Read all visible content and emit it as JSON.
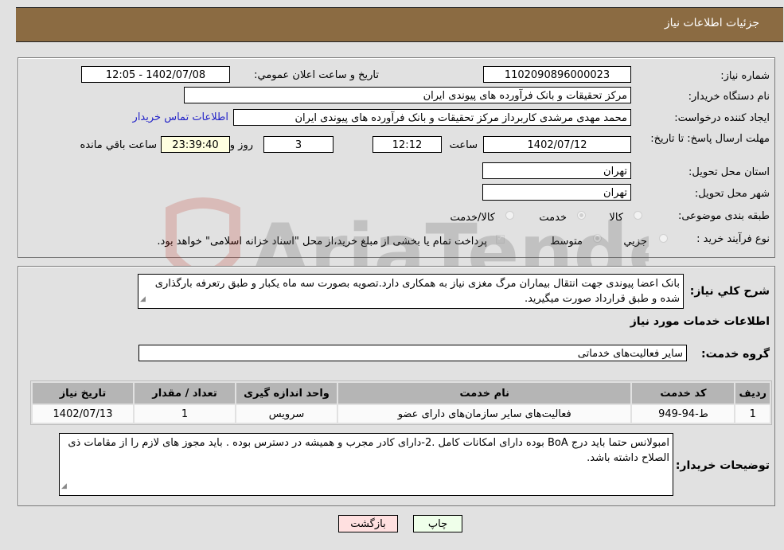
{
  "header": {
    "title": "جزئیات اطلاعات نیاز"
  },
  "need_info": {
    "need_number_label": "شماره نیاز:",
    "need_number": "1102090896000023",
    "announce_label": "تاریخ و ساعت اعلان عمومي:",
    "announce_value": "1402/07/08 - 12:05",
    "buyer_org_label": "نام دستگاه خریدار:",
    "buyer_org": "مرکز تحقیقات و بانک فرآورده های پیوندی ایران",
    "creator_label": "ایجاد کننده درخواست:",
    "creator": "محمد مهدی  مرشدی کاربرداز مرکز تحقیقات و بانک فرآورده های پیوندی ایران",
    "buyer_contact_link": "اطلاعات تماس خریدار",
    "deadline_label": "مهلت ارسال پاسخ: تا تاریخ:",
    "deadline_date": "1402/07/12",
    "time_label": "ساعت",
    "deadline_time": "12:12",
    "days_value": "3",
    "days_label": "روز و",
    "remaining_time": "23:39:40",
    "remaining_label": "ساعت باقي مانده",
    "province_label": "استان محل تحویل:",
    "province": "تهران",
    "city_label": "شهر محل تحویل:",
    "city": "تهران",
    "category_label": "طبقه بندی موضوعی:",
    "category_options": [
      {
        "label": "کالا",
        "selected": false
      },
      {
        "label": "خدمت",
        "selected": true
      },
      {
        "label": "کالا/خدمت",
        "selected": false
      }
    ],
    "process_label": "نوع فرآیند خرید :",
    "process_options": [
      {
        "label": "جزيي",
        "selected": false
      },
      {
        "label": "متوسط",
        "selected": true
      }
    ],
    "treasury_note": "پرداخت تمام یا بخشی از مبلغ خرید،از محل \"اسناد خزانه اسلامی\" خواهد بود.",
    "treasury_checked": true
  },
  "description": {
    "label": "شرح كلي نياز:",
    "text": "بانک اعضا پیوندی جهت انتقال بیماران مرگ مغزی نیاز به همکاری دارد.تصویه بصورت سه ماه یکبار و طبق رتعرفه بارگذاری شده و طبق قرارداد صورت میگیرید."
  },
  "services": {
    "section_title": "اطلاعات خدمات مورد نیاز",
    "group_label": "گروه خدمت:",
    "group_value": "سایر فعالیت‌های خدماتی",
    "columns": [
      "ردیف",
      "کد خدمت",
      "نام خدمت",
      "واحد اندازه گیری",
      "تعداد / مقدار",
      "تاریخ نیاز"
    ],
    "rows": [
      [
        "1",
        "ط-94-949",
        "فعالیت‌های سایر سازمان‌های دارای عضو",
        "سرویس",
        "1",
        "1402/07/13"
      ]
    ]
  },
  "buyer_notes": {
    "label": "توضیحات خریدار:",
    "text": "امبولانس حتما باید درج BoA بوده دارای امکانات کامل .2-دارای کادر مجرب و همیشه در دسترس بوده . باید مجوز های لازم را از مقامات ذی الصلاح داشته باشد."
  },
  "buttons": {
    "print": "چاپ",
    "back": "بازگشت"
  },
  "watermark": {
    "text": "AriaTender.neT"
  }
}
